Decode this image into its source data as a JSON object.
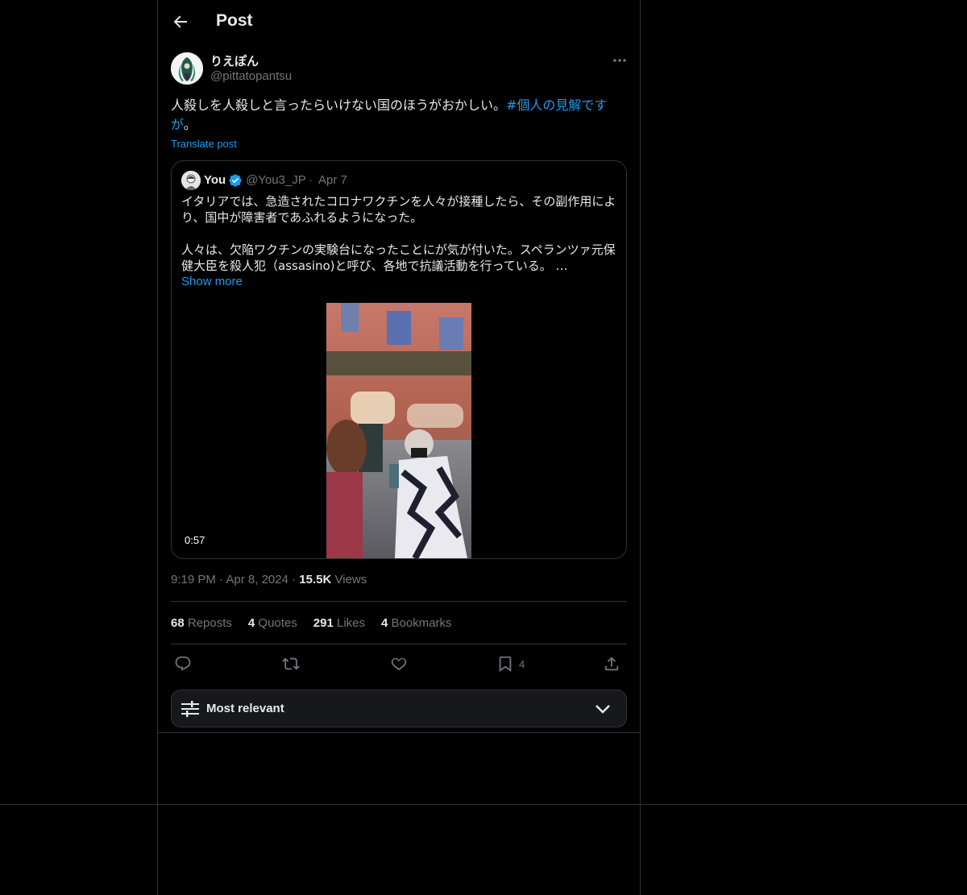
{
  "header": {
    "title": "Post"
  },
  "post": {
    "display_name": "りえぽん",
    "handle": "@pittatopantsu",
    "text_main": "人殺しを人殺しと言ったらいけない国のほうがおかしい。",
    "hashtag": "#個人の見解ですが",
    "text_end": "。",
    "translate_label": "Translate post",
    "time": "9:19 PM",
    "sep": "·",
    "date": "Apr 8, 2024",
    "views_count": "15.5K",
    "views_label": "Views"
  },
  "quote": {
    "name": "You",
    "handle": "@You3_JP",
    "sep": "·",
    "date": "Apr 7",
    "text": "イタリアでは、急造されたコロナワクチンを人々が接種したら、その副作用により、国中が障害者であふれるようになった。\n\n人々は、欠陥ワクチンの実験台になったことにが気が付いた。スペランツァ元保健大臣を殺人犯（assasino)と呼び、各地で抗議活動を行っている。 …",
    "show_more": "Show more",
    "video_duration": "0:57"
  },
  "stats": [
    {
      "count": "68",
      "label": "Reposts"
    },
    {
      "count": "4",
      "label": "Quotes"
    },
    {
      "count": "291",
      "label": "Likes"
    },
    {
      "count": "4",
      "label": "Bookmarks"
    }
  ],
  "actions": {
    "bookmark_count": "4"
  },
  "sort": {
    "label": "Most relevant"
  },
  "icons": [
    "arrow-left-icon",
    "more-icon",
    "verified-icon",
    "reply-icon",
    "repost-icon",
    "like-icon",
    "bookmark-icon",
    "share-icon",
    "sliders-icon",
    "chevron-down-icon"
  ],
  "colors": {
    "accent": "#1d9bf0",
    "background": "#000000",
    "muted": "#71767b",
    "border": "#2f3336"
  }
}
